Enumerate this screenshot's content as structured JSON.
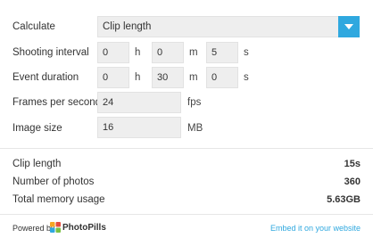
{
  "calculate": {
    "label": "Calculate",
    "selected": "Clip length"
  },
  "shooting_interval": {
    "label": "Shooting interval",
    "h": "0",
    "m": "0",
    "s": "5"
  },
  "event_duration": {
    "label": "Event duration",
    "h": "0",
    "m": "30",
    "s": "0"
  },
  "units": {
    "h": "h",
    "m": "m",
    "s": "s"
  },
  "fps": {
    "label": "Frames per second",
    "value": "24",
    "unit": "fps"
  },
  "image_size": {
    "label": "Image size",
    "value": "16",
    "unit": "MB"
  },
  "results": [
    {
      "label": "Clip length",
      "value": "15s"
    },
    {
      "label": "Number of photos",
      "value": "360"
    },
    {
      "label": "Total memory usage",
      "value": "5.63GB"
    }
  ],
  "footer": {
    "powered_by": "Powered by",
    "brand": "PhotoPills",
    "embed": "Embed it on your website"
  },
  "colors": {
    "accent": "#2fa8df",
    "field_bg": "#eeeeee"
  },
  "icons": {
    "dropdown": "chevron-down-icon",
    "logo": "photopills-logo-icon"
  }
}
